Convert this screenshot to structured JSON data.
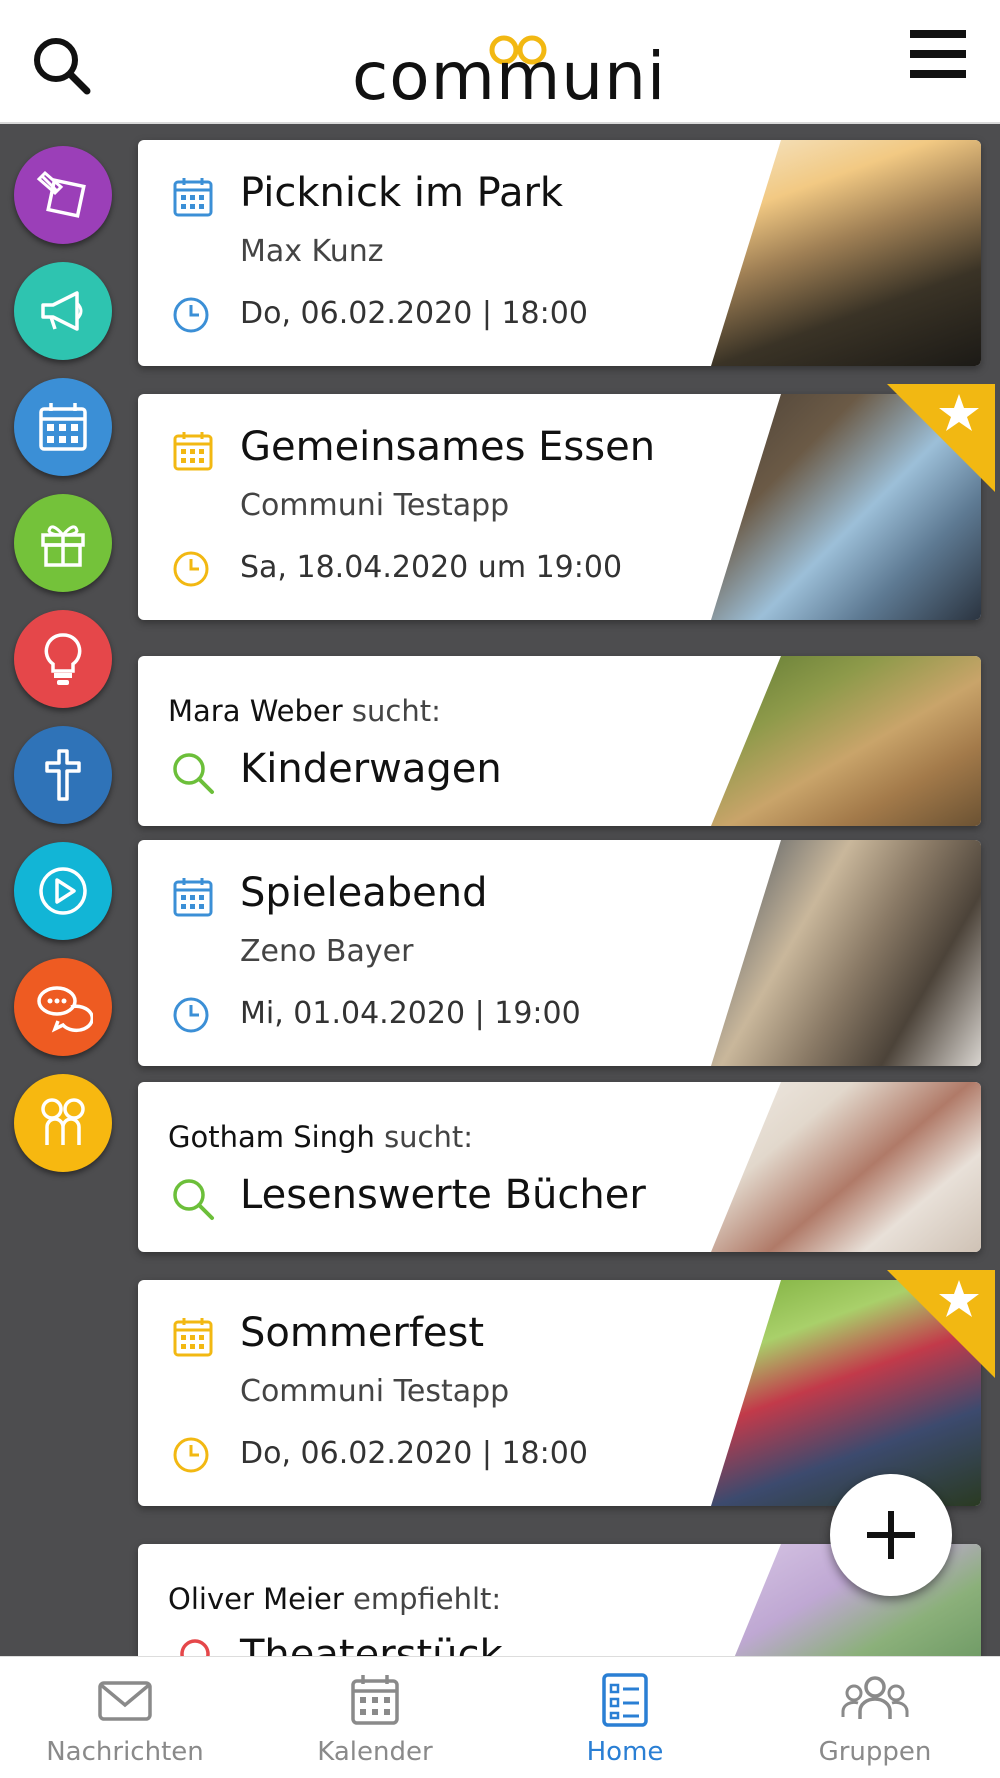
{
  "app": {
    "logo_text": "communi"
  },
  "header": {
    "search_icon": "search-icon",
    "menu_icon": "hamburger-menu-icon"
  },
  "rail": [
    {
      "name": "pinboard",
      "icon": "pin-note-icon",
      "color": "#9b3fb8"
    },
    {
      "name": "announcements",
      "icon": "megaphone-icon",
      "color": "#2ec4b0"
    },
    {
      "name": "events",
      "icon": "calendar-icon",
      "color": "#3b8fd6"
    },
    {
      "name": "gifts",
      "icon": "gift-icon",
      "color": "#74c23a"
    },
    {
      "name": "ideas",
      "icon": "lightbulb-icon",
      "color": "#e5474a"
    },
    {
      "name": "church",
      "icon": "cross-icon",
      "color": "#2f73b8"
    },
    {
      "name": "media",
      "icon": "play-icon",
      "color": "#12b5d6"
    },
    {
      "name": "chat",
      "icon": "chat-bubbles-icon",
      "color": "#ee5b22"
    },
    {
      "name": "community",
      "icon": "communi-people-icon",
      "color": "#f7b810"
    }
  ],
  "feed": {
    "cards": [
      {
        "type": "event",
        "title": "Picknick im Park",
        "subtitle": "Max Kunz",
        "time": "Do, 06.02.2020 | 18:00",
        "icon_color": "#3b8fd6",
        "starred": false
      },
      {
        "type": "event",
        "title": "Gemeinsames Essen",
        "subtitle": "Communi Testapp",
        "time": "Sa, 18.04.2020 um 19:00",
        "icon_color": "#f2b812",
        "starred": true
      },
      {
        "type": "search",
        "author": "Mara Weber",
        "verb": "sucht:",
        "title": "Kinderwagen"
      },
      {
        "type": "event",
        "title": "Spieleabend",
        "subtitle": "Zeno Bayer",
        "time": "Mi, 01.04.2020 | 19:00",
        "icon_color": "#3b8fd6",
        "starred": false
      },
      {
        "type": "search",
        "author": "Gotham Singh",
        "verb": "sucht:",
        "title": "Lesenswerte Bücher"
      },
      {
        "type": "event",
        "title": "Sommerfest",
        "subtitle": "Communi Testapp",
        "time": "Do, 06.02.2020 | 18:00",
        "icon_color": "#f2b812",
        "starred": true
      },
      {
        "type": "recommend",
        "author": "Oliver Meier",
        "verb": "empfiehlt:",
        "title": "Theaterstück"
      }
    ]
  },
  "fab": {
    "icon": "plus-icon"
  },
  "bottom_nav": [
    {
      "label": "Nachrichten",
      "icon": "envelope-icon",
      "active": false
    },
    {
      "label": "Kalender",
      "icon": "calendar-icon",
      "active": false
    },
    {
      "label": "Home",
      "icon": "home-list-icon",
      "active": true
    },
    {
      "label": "Gruppen",
      "icon": "group-icon",
      "active": false
    }
  ],
  "colors": {
    "accent": "#2a7fd4",
    "search_green": "#6cbf3a",
    "star_yellow": "#f2b812",
    "background": "#4d4d4f"
  }
}
